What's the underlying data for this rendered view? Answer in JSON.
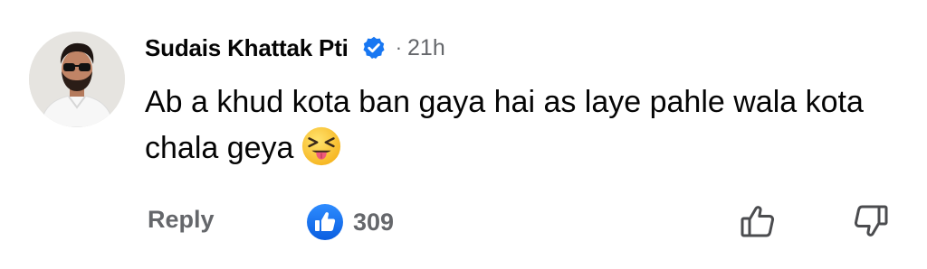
{
  "comment": {
    "author": "Sudais Khattak Pti",
    "separator": "·",
    "time": "21h",
    "text": "Ab a khud kota ban gaya hai as laye pahle wala kota chala geya",
    "emoji": "squinting-face-with-tongue"
  },
  "actions": {
    "reply_label": "Reply",
    "like_count": "309"
  },
  "colors": {
    "verified_blue": "#1877f2",
    "muted_gray": "#65676b",
    "like_blue": "#1877f2"
  },
  "icons": {
    "verified": "verified-badge-icon",
    "like": "like-reaction-icon",
    "thumbs_up": "thumbs-up-icon",
    "thumbs_down": "thumbs-down-icon"
  }
}
